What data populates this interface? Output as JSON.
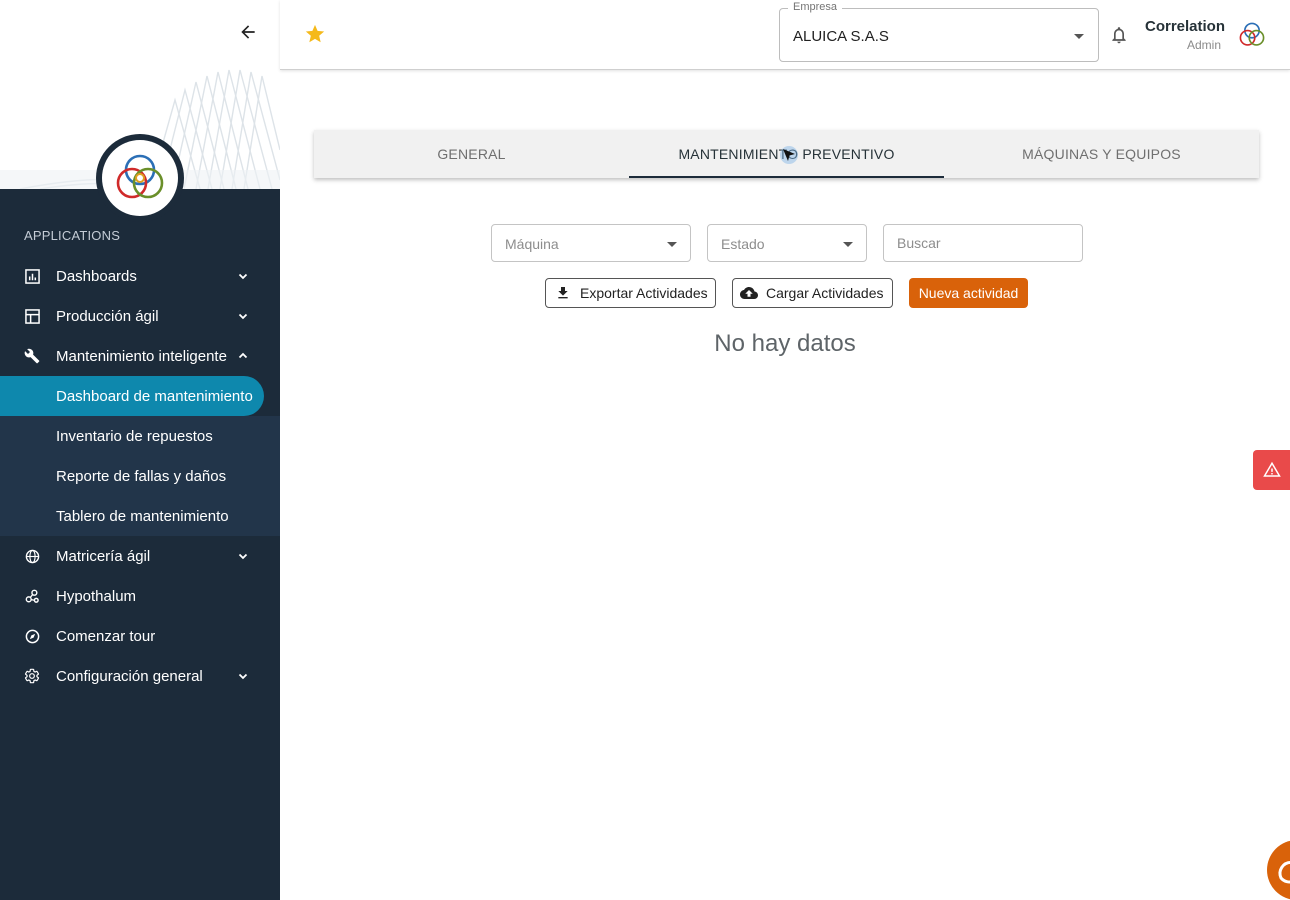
{
  "sidebar": {
    "section_label": "APPLICATIONS",
    "items": [
      {
        "label": "Dashboards",
        "icon": "chart-icon",
        "expandable": true
      },
      {
        "label": "Producción ágil",
        "icon": "layout-icon",
        "expandable": true
      },
      {
        "label": "Mantenimiento inteligente",
        "icon": "wrench-icon",
        "expandable": true,
        "expanded": true
      },
      {
        "label": "Matricería ágil",
        "icon": "globe-icon",
        "expandable": true
      },
      {
        "label": "Hypothalum",
        "icon": "molecule-icon",
        "expandable": false
      },
      {
        "label": "Comenzar tour",
        "icon": "compass-icon",
        "expandable": false
      },
      {
        "label": "Configuración general",
        "icon": "gear-icon",
        "expandable": true
      }
    ],
    "sub_items": [
      {
        "label": "Dashboard de mantenimiento",
        "active": true
      },
      {
        "label": "Inventario de repuestos",
        "active": false
      },
      {
        "label": "Reporte de fallas y daños",
        "active": false
      },
      {
        "label": "Tablero de mantenimiento",
        "active": false
      }
    ]
  },
  "header": {
    "empresa_label": "Empresa",
    "empresa_value": "ALUICA S.A.S",
    "user_name": "Correlation",
    "user_role": "Admin"
  },
  "tabs": [
    {
      "label": "GENERAL",
      "active": false
    },
    {
      "label": "MANTENIMIENTO PREVENTIVO",
      "active": true
    },
    {
      "label": "MÁQUINAS Y EQUIPOS",
      "active": false
    }
  ],
  "filters": {
    "maquina_placeholder": "Máquina",
    "estado_placeholder": "Estado",
    "buscar_placeholder": "Buscar"
  },
  "actions": {
    "export_label": "Exportar Actividades",
    "upload_label": "Cargar Actividades",
    "new_label": "Nueva actividad"
  },
  "empty_state": "No hay datos",
  "colors": {
    "sidebar_bg": "#1c2b3a",
    "active_item": "#0e88ad",
    "primary": "#d9620a",
    "star": "#f5b91a",
    "report_button": "#e94a4a"
  }
}
